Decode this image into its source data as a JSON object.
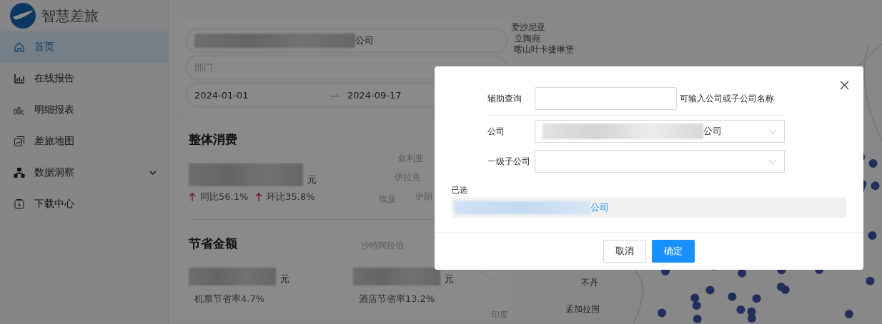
{
  "sidebar": {
    "logo_text": "智慧差旅",
    "items": [
      {
        "label": "首页",
        "kind": "link",
        "selected": true
      },
      {
        "label": "在线报告",
        "kind": "link",
        "selected": false
      },
      {
        "label": "明细报表",
        "kind": "link",
        "selected": false
      },
      {
        "label": "差旅地图",
        "kind": "link",
        "selected": false
      },
      {
        "label": "数据洞察",
        "kind": "submenu",
        "selected": false
      },
      {
        "label": "下载中心",
        "kind": "link",
        "selected": false
      }
    ]
  },
  "filters": {
    "company": "公司",
    "department_placeholder": "部门",
    "start_date": "2024-01-01",
    "end_date": "2024-09-17"
  },
  "overall": {
    "title": "整体消费",
    "unit": "元",
    "changes": [
      {
        "label": "同比56.1%",
        "kind": "rise"
      },
      {
        "label": "环比35.8%",
        "kind": "rise"
      }
    ]
  },
  "savings": {
    "title": "节省金额",
    "items": [
      {
        "unit": "元",
        "label": "机票节省率4.7%"
      },
      {
        "unit": "元",
        "label": "酒店节省率13.2%"
      }
    ]
  },
  "map": {
    "labels": [
      "爱沙尼亚",
      "立陶宛",
      "喀山",
      "叶卡捷琳堡",
      "叙利亚",
      "伊拉克",
      "埃及",
      "伊朗",
      "沙特阿拉伯",
      "不丹",
      "孟加拉国",
      "印度"
    ]
  },
  "dialog": {
    "search_label": "辅助查询",
    "search_hint": "可输入公司或子公司名称",
    "company_label": "公司",
    "company_value": "公司",
    "subsidiary_label": "一级子公司",
    "selected_label": "已选",
    "selected_value": "公司",
    "buttons": [
      {
        "label": "取消",
        "kind": "secondary"
      },
      {
        "label": "确定",
        "kind": "primary"
      }
    ]
  }
}
